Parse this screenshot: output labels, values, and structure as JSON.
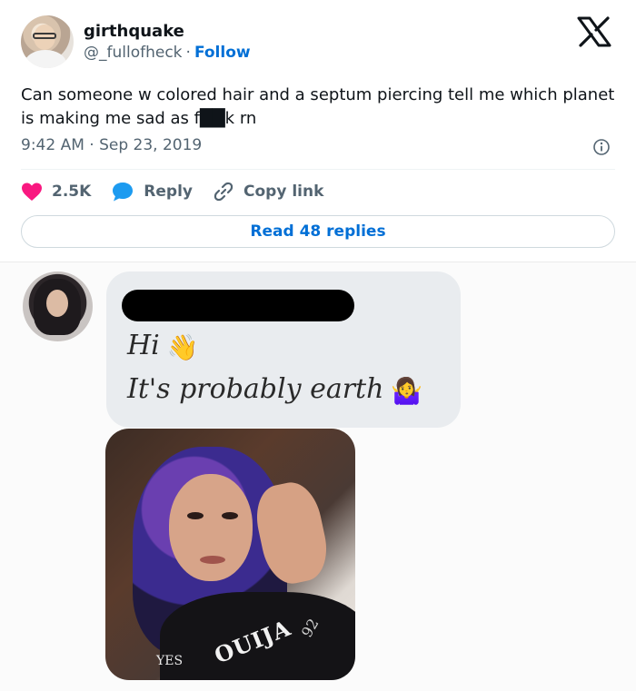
{
  "tweet": {
    "display_name": "girthquake",
    "handle": "@_fullofheck",
    "separator": "·",
    "follow_label": "Follow",
    "text": "Can someone w colored hair and a septum piercing tell me which planet is making me sad as f██k rn",
    "timestamp": "9:42 AM · Sep 23, 2019",
    "likes": "2.5K",
    "reply_label": "Reply",
    "copy_link_label": "Copy link",
    "read_replies_label": "Read 48 replies",
    "colors": {
      "like": "#f91880",
      "reply": "#1d9bf0",
      "link": "#006fd6"
    }
  },
  "message": {
    "line1": "Hi",
    "line1_emoji": "👋",
    "line2": "It's probably earth",
    "line2_emoji": "🤷‍♀️",
    "photo_shirt_text": "OUIJA",
    "photo_shirt_small": "YES",
    "photo_shirt_num": "92"
  },
  "icons": {
    "brand": "x-logo-icon",
    "info": "info-icon",
    "like": "heart-icon",
    "reply": "speech-bubble-icon",
    "copy_link": "link-icon"
  }
}
